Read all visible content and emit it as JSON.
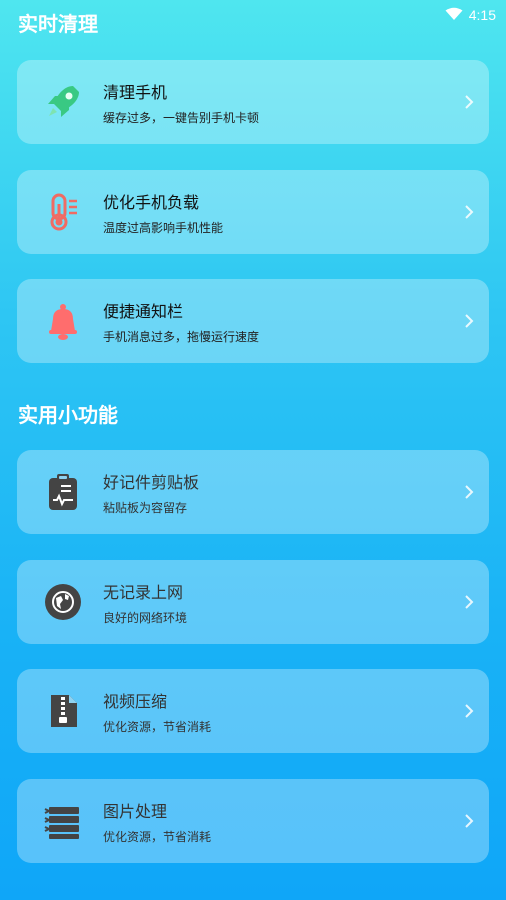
{
  "status_bar": {
    "time": "4:15",
    "wifi_icon": "wifi-icon"
  },
  "sections": {
    "realtime": {
      "title": "实时清理"
    },
    "tools": {
      "title": "实用小功能"
    }
  },
  "cards": [
    {
      "title": "清理手机",
      "subtitle": "缓存过多，一键告别手机卡顿",
      "icon": "rocket-icon",
      "color": "#3fcf86"
    },
    {
      "title": "优化手机负载",
      "subtitle": "温度过高影响手机性能",
      "icon": "thermometer-icon",
      "color": "#f06b63"
    },
    {
      "title": "便捷通知栏",
      "subtitle": "手机消息过多，拖慢运行速度",
      "icon": "bell-icon",
      "color": "#ff6d6d"
    },
    {
      "title": "好记件剪贴板",
      "subtitle": "粘贴板为容留存",
      "icon": "clipboard-icon",
      "color": "#444444"
    },
    {
      "title": "无记录上网",
      "subtitle": "良好的网络环境",
      "icon": "globe-icon",
      "color": "#444444"
    },
    {
      "title": "视频压缩",
      "subtitle": "优化资源，节省消耗",
      "icon": "zip-file-icon",
      "color": "#444444"
    },
    {
      "title": "图片处理",
      "subtitle": "优化资源，节省消耗",
      "icon": "layers-icon",
      "color": "#444444"
    }
  ]
}
